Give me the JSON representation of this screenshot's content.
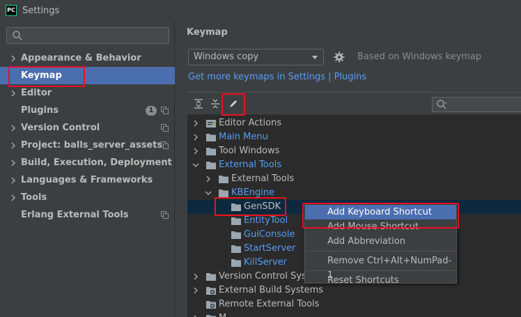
{
  "window": {
    "app_icon_text": "PC",
    "title": "Settings"
  },
  "sidebar": {
    "search_placeholder": "",
    "items": [
      {
        "label": "Appearance & Behavior",
        "expandable": true
      },
      {
        "label": "Keymap",
        "expandable": false,
        "selected": true
      },
      {
        "label": "Editor",
        "expandable": true
      },
      {
        "label": "Plugins",
        "expandable": false,
        "badge": "1",
        "project_icon": true
      },
      {
        "label": "Version Control",
        "expandable": true,
        "project_icon": true
      },
      {
        "label": "Project: balls_server_assets",
        "expandable": true,
        "project_icon": true
      },
      {
        "label": "Build, Execution, Deployment",
        "expandable": true
      },
      {
        "label": "Languages & Frameworks",
        "expandable": true
      },
      {
        "label": "Tools",
        "expandable": true
      },
      {
        "label": "Erlang External Tools",
        "expandable": false,
        "project_icon": true
      }
    ]
  },
  "main": {
    "title": "Keymap",
    "keymap_select_value": "Windows copy",
    "based_on": "Based on Windows keymap",
    "more_link": "Get more keymaps in Settings | Plugins",
    "filter_placeholder": "",
    "tree": [
      {
        "label": "Editor Actions",
        "level": 0,
        "chevron": "right",
        "icon": "editor-actions",
        "blue": false
      },
      {
        "label": "Main Menu",
        "level": 0,
        "chevron": "right",
        "icon": "folder",
        "blue": true
      },
      {
        "label": "Tool Windows",
        "level": 0,
        "chevron": "right",
        "icon": "folder",
        "blue": false
      },
      {
        "label": "External Tools",
        "level": 0,
        "chevron": "down",
        "icon": "folder",
        "blue": true
      },
      {
        "label": "External Tools",
        "level": 1,
        "chevron": "right",
        "icon": "folder",
        "blue": false
      },
      {
        "label": "KBEngine",
        "level": 1,
        "chevron": "down",
        "icon": "folder",
        "blue": true
      },
      {
        "label": "GenSDK",
        "level": 2,
        "chevron": "",
        "icon": "folder",
        "blue": false,
        "selected": true
      },
      {
        "label": "EntityTool",
        "level": 2,
        "chevron": "",
        "icon": "folder",
        "blue": true
      },
      {
        "label": "GuiConsole",
        "level": 2,
        "chevron": "",
        "icon": "folder",
        "blue": true
      },
      {
        "label": "StartServer",
        "level": 2,
        "chevron": "",
        "icon": "folder",
        "blue": true
      },
      {
        "label": "KillServer",
        "level": 2,
        "chevron": "",
        "icon": "folder",
        "blue": true
      },
      {
        "label": "Version Control Systems",
        "level": 0,
        "chevron": "right",
        "icon": "folder",
        "blue": false
      },
      {
        "label": "External Build Systems",
        "level": 0,
        "chevron": "right",
        "icon": "gear-folder",
        "blue": false
      },
      {
        "label": "Remote External Tools",
        "level": 0,
        "chevron": "",
        "icon": "gear-folder",
        "blue": false
      },
      {
        "label": "M",
        "level": 0,
        "chevron": "right",
        "icon": "folder",
        "blue": false
      }
    ]
  },
  "context_menu": {
    "items": [
      {
        "label": "Add Keyboard Shortcut",
        "active": true
      },
      {
        "label": "Add Mouse Shortcut"
      },
      {
        "label": "Add Abbreviation"
      },
      {
        "separator": true
      },
      {
        "label": "Remove Ctrl+Alt+NumPad-1"
      },
      {
        "separator": true
      },
      {
        "label": "Reset Shortcuts"
      }
    ]
  },
  "colors": {
    "background": "#3c3f41",
    "tree_background": "#2b2b2b",
    "selection": "#4b6eaf",
    "link": "#589df6",
    "highlight_frame": "#e81123"
  }
}
